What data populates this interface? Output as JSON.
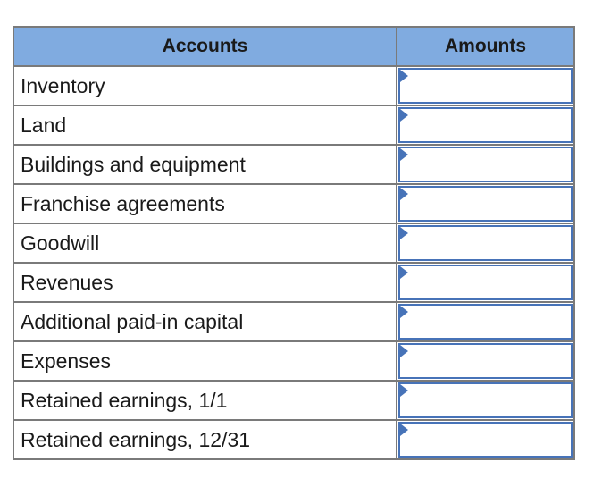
{
  "table": {
    "headers": {
      "accounts": "Accounts",
      "amounts": "Amounts"
    },
    "rows": [
      {
        "account": "Inventory",
        "amount": ""
      },
      {
        "account": "Land",
        "amount": ""
      },
      {
        "account": "Buildings and equipment",
        "amount": ""
      },
      {
        "account": "Franchise agreements",
        "amount": ""
      },
      {
        "account": "Goodwill",
        "amount": ""
      },
      {
        "account": "Revenues",
        "amount": ""
      },
      {
        "account": "Additional paid-in capital",
        "amount": ""
      },
      {
        "account": "Expenses",
        "amount": ""
      },
      {
        "account": "Retained earnings, 1/1",
        "amount": ""
      },
      {
        "account": "Retained earnings, 12/31",
        "amount": ""
      }
    ]
  },
  "colors": {
    "header_bg": "#80abe0",
    "input_border": "#4773b8",
    "grid": "#7a7a7a"
  }
}
